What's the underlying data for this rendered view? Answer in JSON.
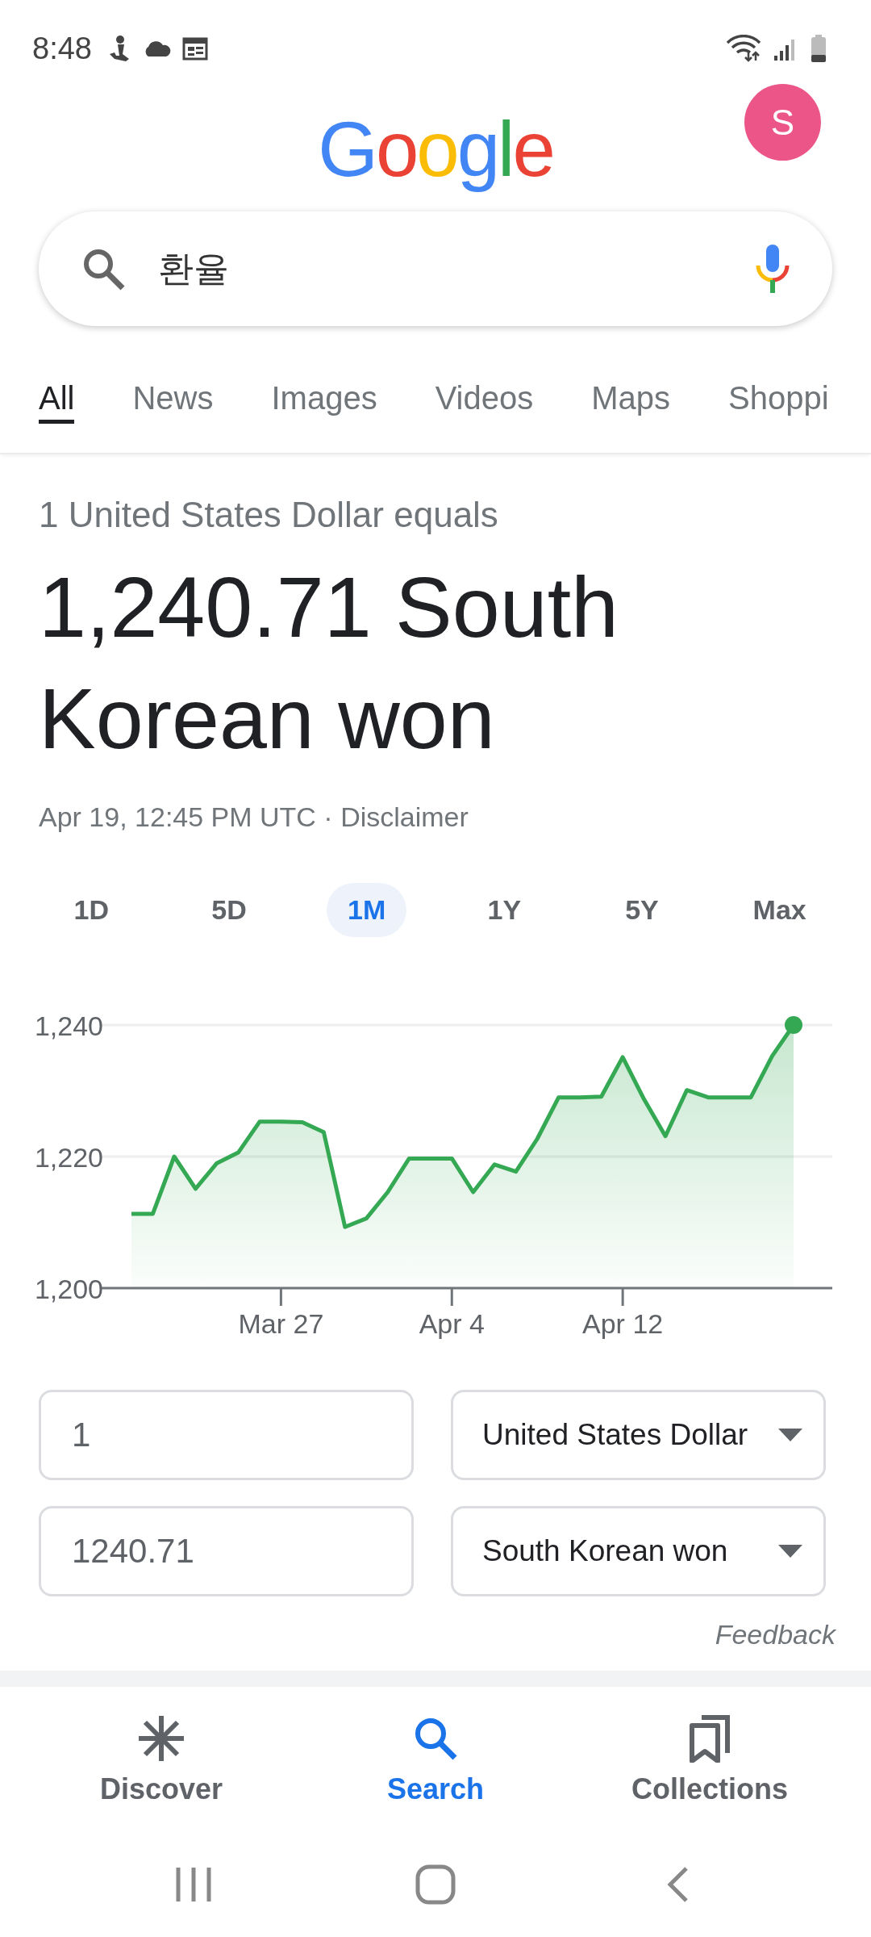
{
  "status_bar": {
    "time": "8:48"
  },
  "header": {
    "logo": "Google",
    "avatar": "S"
  },
  "search": {
    "query": "환율"
  },
  "tabs": [
    {
      "label": "All",
      "selected": true
    },
    {
      "label": "News",
      "selected": false
    },
    {
      "label": "Images",
      "selected": false
    },
    {
      "label": "Videos",
      "selected": false
    },
    {
      "label": "Maps",
      "selected": false
    },
    {
      "label": "Shoppi",
      "selected": false
    }
  ],
  "result": {
    "intro": "1 United States Dollar equals",
    "value": "1,240.71 South Korean won",
    "timestamp": "Apr 19, 12:45 PM UTC ·",
    "disclaimer": "Disclaimer",
    "ranges": [
      {
        "label": "1D",
        "selected": false
      },
      {
        "label": "5D",
        "selected": false
      },
      {
        "label": "1M",
        "selected": true
      },
      {
        "label": "1Y",
        "selected": false
      },
      {
        "label": "5Y",
        "selected": false
      },
      {
        "label": "Max",
        "selected": false
      }
    ],
    "chart_data": {
      "type": "area",
      "categories": [
        null,
        null,
        null,
        null,
        null,
        null,
        null,
        "Mar 27",
        null,
        null,
        null,
        null,
        null,
        null,
        null,
        "Apr 4",
        null,
        null,
        null,
        null,
        null,
        null,
        null,
        "Apr 12",
        null,
        null,
        null,
        null,
        null,
        null,
        null,
        null
      ],
      "series": [
        {
          "color": "#34a853",
          "values": [
            1211.3,
            1211.3,
            1220.0,
            1215.1,
            1219.0,
            1220.6,
            1225.3,
            1225.3,
            1225.2,
            1223.7,
            1209.3,
            1210.6,
            1214.6,
            1219.7,
            1219.7,
            1219.7,
            1214.6,
            1218.8,
            1217.7,
            1222.7,
            1229.0,
            1229.0,
            1229.1,
            1235.1,
            1228.7,
            1223.1,
            1230.1,
            1229.0,
            1229.0,
            1229.0,
            1235.3,
            1240.0
          ]
        }
      ],
      "ylim": [
        1200,
        1240
      ],
      "yticks": [
        {
          "value": 1200,
          "label": "1,200"
        },
        {
          "value": 1220,
          "label": "1,220"
        },
        {
          "value": 1240,
          "label": "1,240"
        }
      ]
    },
    "converter": [
      {
        "amount": "1",
        "currency": "United States Dollar"
      },
      {
        "amount": "1240.71",
        "currency": "South Korean won"
      }
    ],
    "feedback": "Feedback"
  },
  "bottom_nav": [
    {
      "label": "Discover",
      "kind": "discover",
      "selected": false
    },
    {
      "label": "Search",
      "kind": "search",
      "selected": true
    },
    {
      "label": "Collections",
      "kind": "collections",
      "selected": false
    }
  ]
}
